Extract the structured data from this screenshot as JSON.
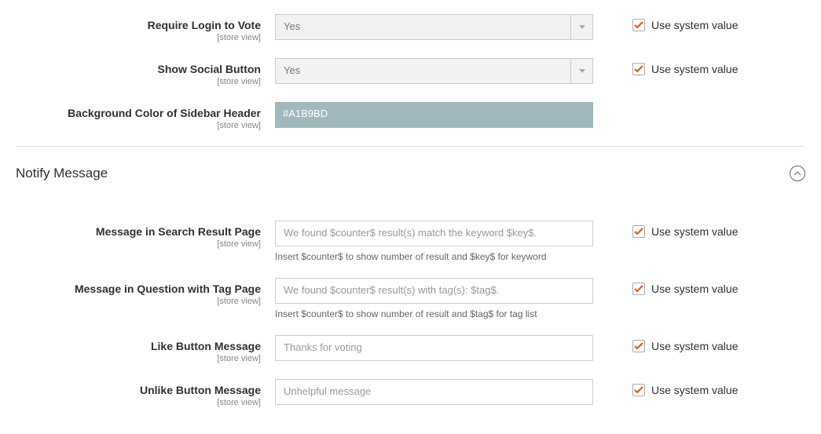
{
  "common": {
    "scope": "[store view]",
    "system_value": "Use system value",
    "colors": {
      "sidebar_header_bg": "#A1B9BD",
      "checkmark": "#EB5202"
    }
  },
  "top": {
    "require_login": {
      "label": "Require Login to Vote",
      "value": "Yes"
    },
    "show_social": {
      "label": "Show Social Button",
      "value": "Yes"
    },
    "bg_color": {
      "label": "Background Color of Sidebar Header",
      "value": "#A1B9BD"
    }
  },
  "section": {
    "title": "Notify Message"
  },
  "notify": {
    "search_result": {
      "label": "Message in Search Result Page",
      "placeholder": "We found $counter$ result(s) match the keyword $key$.",
      "help": "Insert $counter$ to show number of result and $key$ for keyword"
    },
    "tag_page": {
      "label": "Message in Question with Tag Page",
      "placeholder": "We found $counter$ result(s) with tag(s): $tag$.",
      "help": "Insert $counter$ to show number of result and $tag$ for tag list"
    },
    "like": {
      "label": "Like Button Message",
      "placeholder": "Thanks for voting"
    },
    "unlike": {
      "label": "Unlike Button Message",
      "placeholder": "Unhelpful message"
    }
  }
}
